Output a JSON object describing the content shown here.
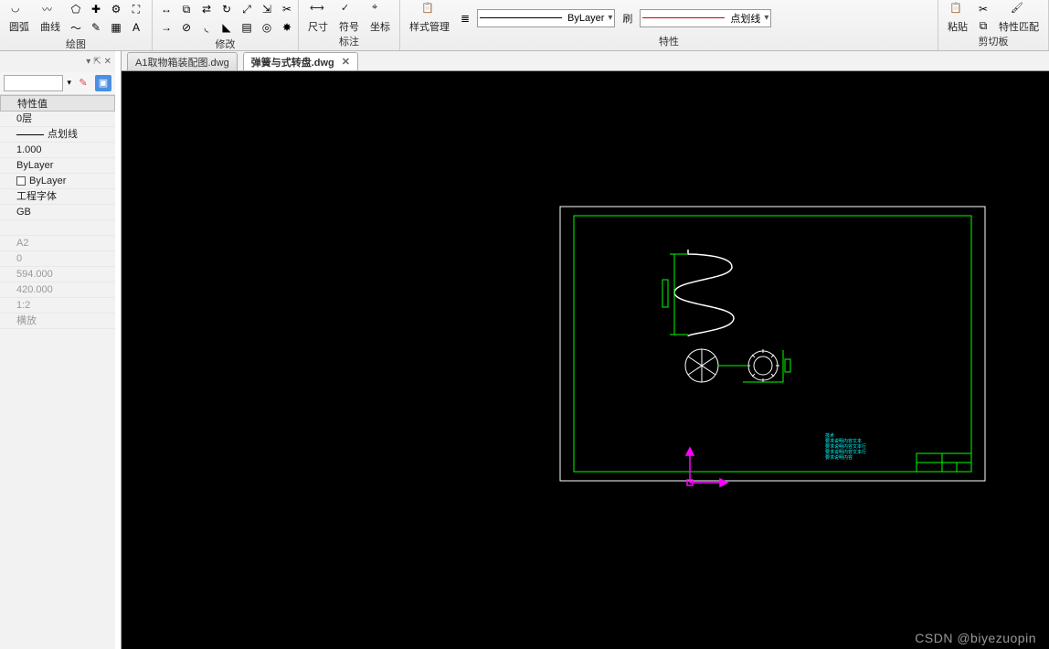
{
  "ribbon": {
    "groups": {
      "draw": {
        "label": "绘图",
        "arc_label": "圆弧",
        "curve_label": "曲线"
      },
      "modify": {
        "label": "修改"
      },
      "annotation": {
        "label": "标注",
        "dim_label": "尺寸",
        "symbol_label": "符号",
        "coord_label": "坐标"
      },
      "properties": {
        "label": "特性",
        "style_mgr_label": "样式管理",
        "layer_swatch_label": "ByLayer",
        "lt_swatch_label": "点划线",
        "refresh_label": "刷"
      },
      "clipboard": {
        "label": "剪切板",
        "paste_label": "粘贴",
        "props_match_label": "特性匹配"
      }
    }
  },
  "tabs": {
    "items": [
      {
        "id": "tab0",
        "label": "A1取物箱装配图.dwg",
        "active": false
      },
      {
        "id": "tab1",
        "label": "弹簧与式转盘.dwg",
        "active": true
      }
    ]
  },
  "properties_panel": {
    "header_icons": {
      "down": "▾",
      "pin": "⇱",
      "close": "✕"
    },
    "column_header": "特性值",
    "rows": [
      {
        "text": "0层",
        "dim": false,
        "type": "plain"
      },
      {
        "text": "点划线",
        "dim": false,
        "type": "line"
      },
      {
        "text": "1.000",
        "dim": false
      },
      {
        "text": "ByLayer",
        "dim": false
      },
      {
        "text": "ByLayer",
        "dim": false,
        "type": "color"
      },
      {
        "text": "工程字体",
        "dim": false
      },
      {
        "text": "GB",
        "dim": false
      },
      {
        "text": "",
        "dim": false
      },
      {
        "text": "A2",
        "dim": true
      },
      {
        "text": "0",
        "dim": true
      },
      {
        "text": "594.000",
        "dim": true
      },
      {
        "text": "420.000",
        "dim": true
      },
      {
        "text": "1:2",
        "dim": true
      },
      {
        "text": "横放",
        "dim": true
      }
    ]
  },
  "canvas": {
    "frame_color": "#ffffff",
    "inner_color": "#00ff00",
    "spring_color": "#ffffff",
    "annotation_color": "#00ffff",
    "axis_color": "#ff00ff"
  },
  "watermark": "CSDN @biyezuopin"
}
